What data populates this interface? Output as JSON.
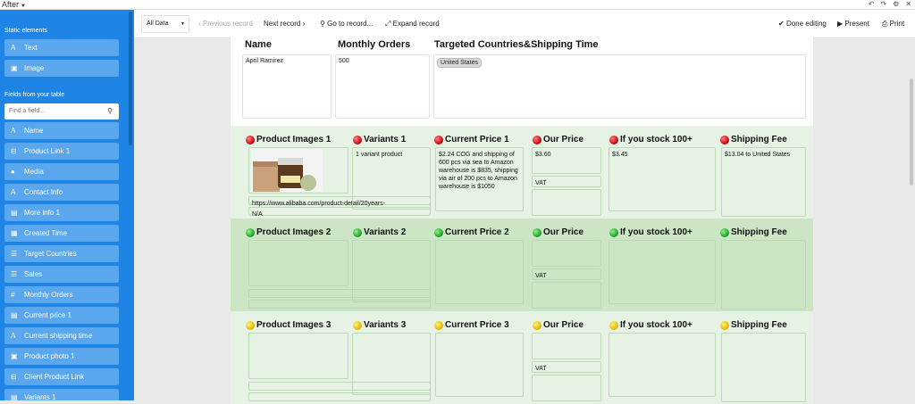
{
  "window": {
    "title": "After"
  },
  "top_icons": [
    "undo-icon",
    "redo-icon",
    "settings-icon",
    "close-icon"
  ],
  "sidebar": {
    "static_heading": "Static elements",
    "static_items": [
      {
        "label": "Text",
        "icon": "text-icon",
        "glyph": "A"
      },
      {
        "label": "Image",
        "icon": "image-icon",
        "glyph": "▣"
      }
    ],
    "fields_heading": "Fields from your table",
    "search_placeholder": "Find a field...",
    "fields": [
      {
        "label": "Name",
        "icon": "text-field-icon",
        "glyph": "A"
      },
      {
        "label": "Product Link 1",
        "icon": "link-icon",
        "glyph": "⊟"
      },
      {
        "label": "Media",
        "icon": "attachment-icon",
        "glyph": "●"
      },
      {
        "label": "Contact Info",
        "icon": "text-field-icon",
        "glyph": "A"
      },
      {
        "label": "More info 1",
        "icon": "long-text-icon",
        "glyph": "▤"
      },
      {
        "label": "Created Time",
        "icon": "calendar-icon",
        "glyph": "▦"
      },
      {
        "label": "Target Countries",
        "icon": "multi-select-icon",
        "glyph": "☰"
      },
      {
        "label": "Sales",
        "icon": "select-icon",
        "glyph": "☰"
      },
      {
        "label": "Monthly Orders",
        "icon": "number-icon",
        "glyph": "#"
      },
      {
        "label": "Current price 1",
        "icon": "long-text-icon",
        "glyph": "▤"
      },
      {
        "label": "Current shipping time",
        "icon": "text-field-icon",
        "glyph": "A"
      },
      {
        "label": "Product photo 1",
        "icon": "image-icon",
        "glyph": "▣"
      },
      {
        "label": "Client Product Link",
        "icon": "link-icon",
        "glyph": "⊟"
      },
      {
        "label": "Variants 1",
        "icon": "long-text-icon",
        "glyph": "▤"
      }
    ]
  },
  "toolbar": {
    "view_select": "All Data",
    "previous": "Previous record",
    "next": "Next record",
    "goto": "Go to record...",
    "expand": "Expand record",
    "done": "Done editing",
    "present": "Present",
    "print": "Print"
  },
  "record": {
    "headers": {
      "name": "Name",
      "monthly_orders": "Monthly Orders",
      "countries": "Targeted Countries&Shipping Time"
    },
    "name": "April Ramirez",
    "monthly_orders": "500",
    "country_tag": "United States"
  },
  "sections": [
    {
      "color": "red",
      "status_color": "#c0000a",
      "headers": [
        "Product Images 1",
        "Variants 1",
        "Current Price 1",
        "Our Price",
        "If you stock 100+",
        "Shipping Fee"
      ],
      "product_link": "https://www.alibaba.com/product-detail/20years-",
      "extra": "N/A",
      "variants": "1 variant product",
      "current_price": "$2.24 COG and shipping of 600 pcs via sea to Amazon warehouse is $835, shipping via air of 200 pcs to Amazon warehouse is $1050",
      "our_price": "$3.60",
      "vat": "VAT",
      "stock_100": "$3.45",
      "shipping_fee": "$13.04 to United States"
    },
    {
      "color": "green",
      "status_color": "#1b9b24",
      "headers": [
        "Product Images 2",
        "Variants 2",
        "Current Price 2",
        "Our Price",
        "If you stock 100+",
        "Shipping Fee"
      ],
      "vat": "VAT"
    },
    {
      "color": "yellow",
      "status_color": "#e0b400",
      "headers": [
        "Product Images 3",
        "Variants 3",
        "Current Price 3",
        "Our Price",
        "If you stock 100+",
        "Shipping Fee"
      ],
      "vat": "VAT"
    }
  ]
}
